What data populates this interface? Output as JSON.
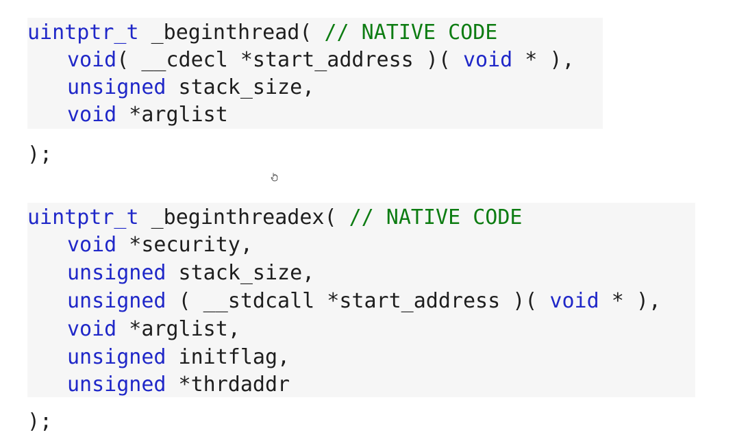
{
  "signature_1": {
    "lines": [
      [
        {
          "t": "uintptr_t",
          "c": "kw"
        },
        {
          "t": " _beginthread( ",
          "c": "tx"
        },
        {
          "t": "// NATIVE CODE",
          "c": "cm"
        }
      ],
      [
        {
          "t": "void",
          "c": "kw"
        },
        {
          "t": "( __cdecl *start_address )( ",
          "c": "tx"
        },
        {
          "t": "void",
          "c": "kw"
        },
        {
          "t": " * ),",
          "c": "tx"
        }
      ],
      [
        {
          "t": "unsigned",
          "c": "kw"
        },
        {
          "t": " stack_size,",
          "c": "tx"
        }
      ],
      [
        {
          "t": "void",
          "c": "kw"
        },
        {
          "t": " *arglist",
          "c": "tx"
        }
      ],
      [
        {
          "t": ");",
          "c": "tx"
        }
      ]
    ]
  },
  "signature_2": {
    "lines": [
      [
        {
          "t": "uintptr_t",
          "c": "kw"
        },
        {
          "t": " _beginthreadex( ",
          "c": "tx"
        },
        {
          "t": "// NATIVE CODE",
          "c": "cm"
        }
      ],
      [
        {
          "t": "void",
          "c": "kw"
        },
        {
          "t": " *security,",
          "c": "tx"
        }
      ],
      [
        {
          "t": "unsigned",
          "c": "kw"
        },
        {
          "t": " stack_size,",
          "c": "tx"
        }
      ],
      [
        {
          "t": "unsigned",
          "c": "kw"
        },
        {
          "t": " ( __stdcall *start_address )( ",
          "c": "tx"
        },
        {
          "t": "void",
          "c": "kw"
        },
        {
          "t": " * ),",
          "c": "tx"
        }
      ],
      [
        {
          "t": "void",
          "c": "kw"
        },
        {
          "t": " *arglist,",
          "c": "tx"
        }
      ],
      [
        {
          "t": "unsigned",
          "c": "kw"
        },
        {
          "t": " initflag,",
          "c": "tx"
        }
      ],
      [
        {
          "t": "unsigned",
          "c": "kw"
        },
        {
          "t": " *thrdaddr",
          "c": "tx"
        }
      ],
      [
        {
          "t": ");",
          "c": "tx"
        }
      ]
    ]
  },
  "colors": {
    "keyword": "#1f27c8",
    "comment": "#0d7c12",
    "text": "#1e1e1e",
    "code_background": "#f6f6f6"
  },
  "cursor": {
    "icon": "hand-cursor-icon"
  }
}
